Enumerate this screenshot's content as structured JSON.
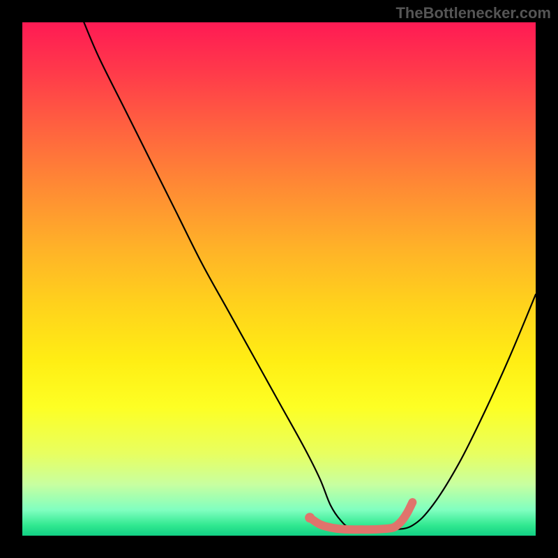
{
  "attribution": "TheBottlenecker.com",
  "chart_data": {
    "type": "line",
    "title": "",
    "xlabel": "",
    "ylabel": "",
    "xlim": [
      0,
      100
    ],
    "ylim": [
      0,
      100
    ],
    "curve": {
      "name": "bottleneck-curve",
      "x": [
        12,
        15,
        20,
        25,
        30,
        35,
        40,
        45,
        50,
        55,
        58,
        60,
        62,
        64,
        68,
        72,
        76,
        80,
        85,
        90,
        95,
        100
      ],
      "y": [
        100,
        93,
        83,
        73,
        63,
        53,
        44,
        35,
        26,
        17,
        11,
        6,
        3,
        1.5,
        1.2,
        1.2,
        2,
        6,
        14,
        24,
        35,
        47
      ]
    },
    "highlight_segment": {
      "name": "optimal-range",
      "color": "#e0746c",
      "x": [
        56,
        58,
        60,
        62,
        64,
        66,
        68,
        70,
        72,
        73,
        74,
        75,
        76
      ],
      "y": [
        3.5,
        2.2,
        1.6,
        1.3,
        1.2,
        1.2,
        1.2,
        1.3,
        1.5,
        2.0,
        3.0,
        4.5,
        6.5
      ]
    },
    "marker": {
      "name": "current-config",
      "color": "#e0746c",
      "x": 56,
      "y": 3.5
    },
    "background_gradient": {
      "top": "#ff1a54",
      "bottom": "#12d084"
    }
  }
}
